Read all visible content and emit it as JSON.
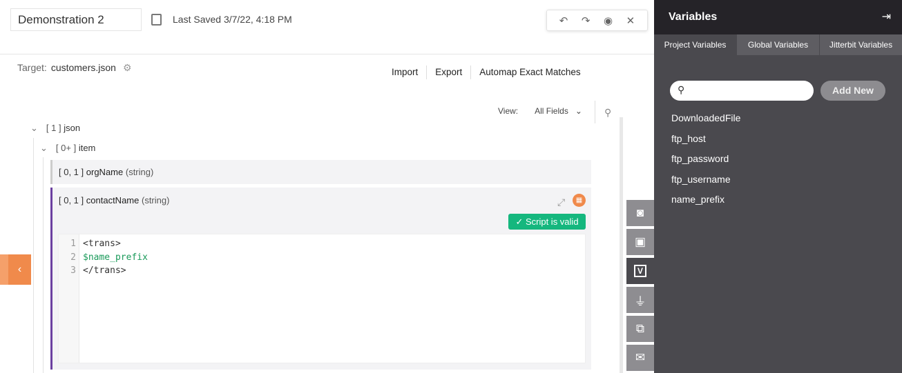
{
  "header": {
    "title": "Demonstration 2",
    "last_saved": "Last Saved 3/7/22, 4:18 PM"
  },
  "toolbar": {
    "undo": "↶",
    "redo": "↷",
    "preview": "◉",
    "close": "✕"
  },
  "target": {
    "label": "Target:",
    "value": "customers.json"
  },
  "actions": [
    "Import",
    "Export",
    "Automap Exact Matches"
  ],
  "view": {
    "label": "View:",
    "selected": "All Fields"
  },
  "tree": {
    "root": {
      "card": "[ 1 ]",
      "name": "json"
    },
    "item": {
      "card": "[ 0+ ]",
      "name": "item"
    },
    "fields": [
      {
        "card": "[ 0, 1 ]",
        "name": "orgName",
        "type": "(string)"
      },
      {
        "card": "[ 0, 1 ]",
        "name": "contactName",
        "type": "(string)"
      }
    ]
  },
  "script": {
    "status": "Script is valid",
    "lines": [
      {
        "n": "1",
        "text": "<trans>"
      },
      {
        "n": "2",
        "text": "$name_prefix"
      },
      {
        "n": "3",
        "text": "</trans>"
      }
    ]
  },
  "panel": {
    "title": "Variables",
    "tabs": [
      "Project Variables",
      "Global Variables",
      "Jitterbit Variables"
    ],
    "active_tab": "Project Variables",
    "search_placeholder": "",
    "add_new": "Add New",
    "variables": [
      "DownloadedFile",
      "ftp_host",
      "ftp_password",
      "ftp_username",
      "name_prefix"
    ]
  },
  "colors": {
    "accent_orange": "#f08a4b",
    "valid_green": "#15b77e",
    "mapping_purple": "#6b3fa0",
    "panel_bg": "#4a494e"
  }
}
